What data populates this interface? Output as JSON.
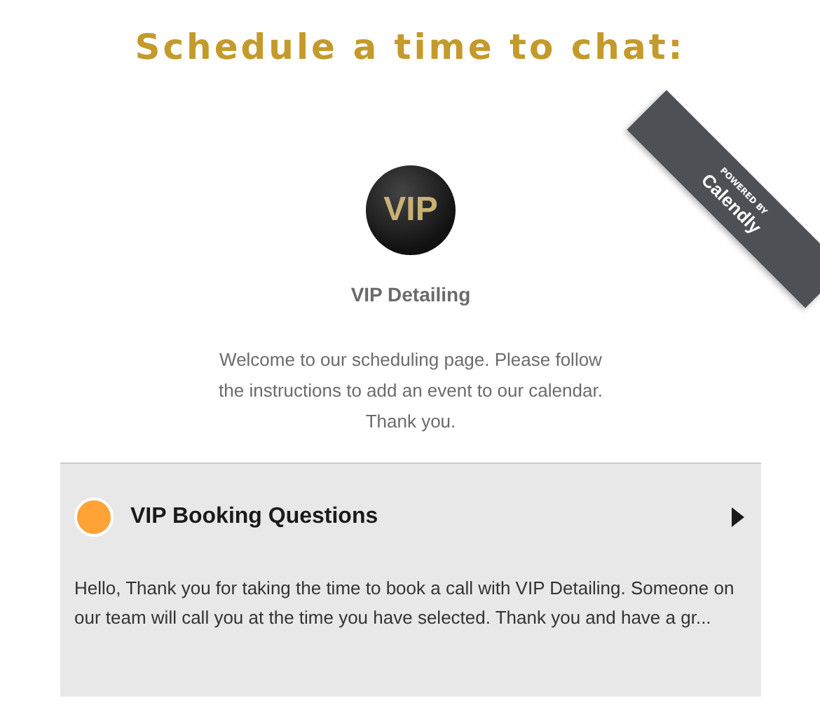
{
  "heading": "Schedule a time to chat:",
  "badge": {
    "small": "POWERED BY",
    "brand": "Calendly"
  },
  "profile": {
    "logo_text": "VIP",
    "name": "VIP Detailing",
    "welcome": "Welcome to our scheduling page. Please follow the instructions to add an event to our calendar. Thank you."
  },
  "event_types": [
    {
      "name": "VIP Booking Questions",
      "color": "#ffa336",
      "description": "Hello, Thank you for taking the time to book a call with VIP Detailing. Someone on our team will call you at the time you have selected. Thank you and have a gr..."
    }
  ]
}
